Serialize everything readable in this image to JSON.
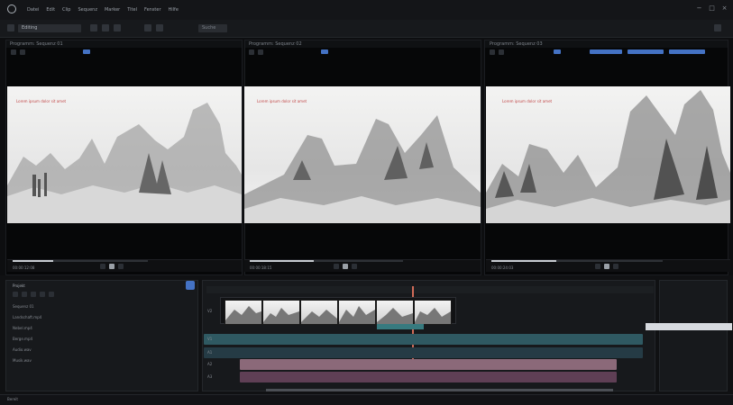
{
  "menu": {
    "items": [
      "Datei",
      "Edit",
      "Clip",
      "Sequenz",
      "Marker",
      "Titel",
      "Fenster",
      "Hilfe"
    ]
  },
  "toolbar": {
    "workspace_label": "Editing",
    "search_placeholder": "Suche"
  },
  "viewers": [
    {
      "title": "Programm: Sequenz 01",
      "timecode": "00:00:12:08",
      "overlay_text": "Lorem ipsum dolor sit amet",
      "progress": 0.3
    },
    {
      "title": "Programm: Sequenz 02",
      "timecode": "00:00:18:15",
      "overlay_text": "Lorem ipsum dolor sit amet",
      "progress": 0.42
    },
    {
      "title": "Programm: Sequenz 03",
      "timecode": "00:00:24:03",
      "overlay_text": "Lorem ipsum dolor sit amet",
      "progress": 0.38
    }
  ],
  "colors": {
    "accent": "#4472c4",
    "track_video": "#2f5962",
    "track_audio": "#8b6979",
    "track_audio_dark": "#5f3f55"
  },
  "project_panel": {
    "title": "Projekt",
    "items": [
      "Sequenz 01",
      "Landschaft.mp4",
      "Nebel.mp4",
      "Berge.mp4",
      "Audio.wav",
      "Musik.wav"
    ]
  },
  "timeline": {
    "tracks": [
      "V2",
      "V1",
      "A1",
      "A2",
      "A3"
    ]
  },
  "status": {
    "text": "Bereit"
  }
}
